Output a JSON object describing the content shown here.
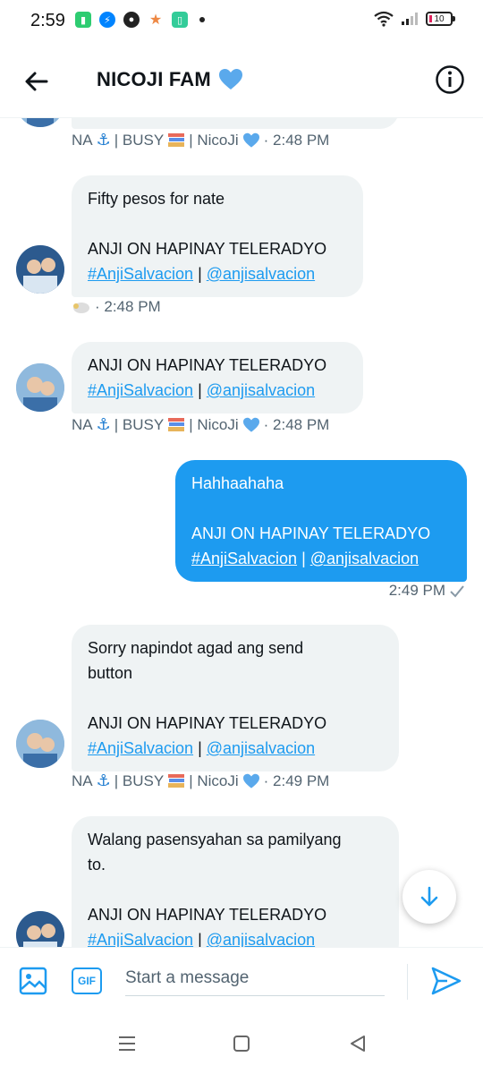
{
  "status_bar": {
    "time": "2:59",
    "battery": "10"
  },
  "header": {
    "title": "NICOJI FAM"
  },
  "messages": [
    {
      "meta": {
        "prefix": "NA",
        "mid": " | BUSY",
        "suffix": " | NicoJi",
        "time": " · 2:48 PM"
      }
    },
    {
      "text": "Fifty pesos for nate",
      "footer": "ANJI ON HAPINAY TELERADYO",
      "hashtag": "#AnjiSalvacion",
      "sep": " | ",
      "handle": "@anjisalvacion",
      "time": " · 2:48 PM"
    },
    {
      "footer": "ANJI ON HAPINAY TELERADYO",
      "hashtag": "#AnjiSalvacion",
      "sep": " | ",
      "handle": "@anjisalvacion",
      "meta": {
        "prefix": "NA",
        "mid": " | BUSY",
        "suffix": " | NicoJi",
        "time": " · 2:48 PM"
      }
    },
    {
      "text": "Hahhaahaha",
      "footer": "ANJI ON HAPINAY TELERADYO",
      "hashtag": "#AnjiSalvacion",
      "sep": " | ",
      "handle": "@anjisalvacion",
      "time": "2:49 PM"
    },
    {
      "text_line1": "Sorry napindot agad ang send",
      "text_line2": "button",
      "footer": "ANJI ON HAPINAY TELERADYO",
      "hashtag": "#AnjiSalvacion",
      "sep": " | ",
      "handle": "@anjisalvacion",
      "meta": {
        "prefix": "NA",
        "mid": " | BUSY",
        "suffix": " | NicoJi",
        "time": " · 2:49 PM"
      }
    },
    {
      "text_line1": "Walang pasensyahan sa pamilyang",
      "text_line2": "to.",
      "footer": "ANJI ON HAPINAY TELERADYO",
      "hashtag": "#AnjiSalvacion",
      "sep": " | ",
      "handle": "@anjisalvacion"
    }
  ],
  "composer": {
    "placeholder": "Start a message",
    "gif_label": "GIF"
  },
  "colors": {
    "accent": "#1d9bf0",
    "bubble_in": "#eff3f4",
    "meta": "#536471"
  }
}
